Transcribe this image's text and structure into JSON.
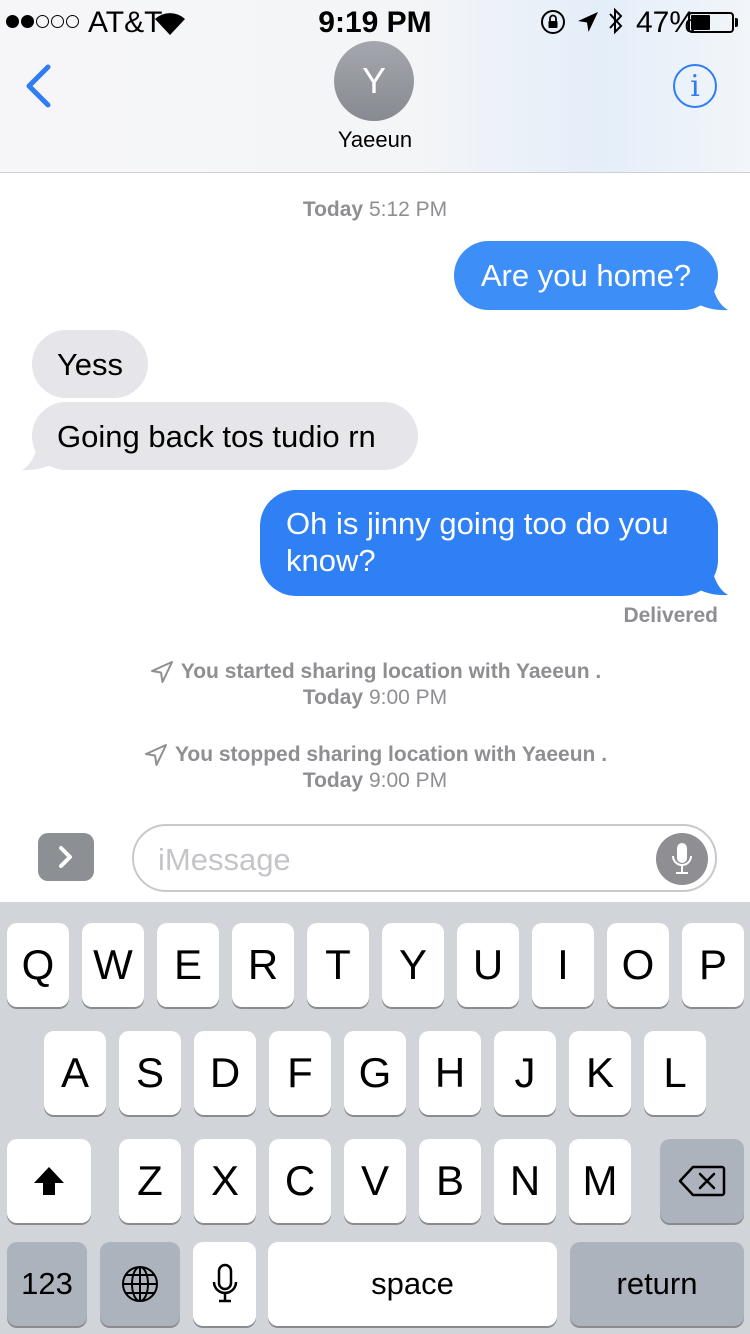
{
  "status_bar": {
    "carrier": "AT&T",
    "time": "9:19 PM",
    "battery_percent": "47%",
    "battery_level": 0.47,
    "signal_bars_filled": 2,
    "signal_bars_total": 5
  },
  "header": {
    "avatar_initial": "Y",
    "contact_name": "Yaeeun",
    "info_label": "i"
  },
  "conversation": {
    "timestamp_day": "Today",
    "timestamp_time": "5:12 PM",
    "messages": [
      {
        "direction": "outgoing",
        "text": "Are you home?"
      },
      {
        "direction": "incoming",
        "text": "Yess"
      },
      {
        "direction": "incoming",
        "text": "Going back tos tudio rn"
      },
      {
        "direction": "outgoing",
        "text": "Oh is jinny going too do you know?"
      }
    ],
    "delivered_label": "Delivered",
    "events": [
      {
        "text": "You started sharing location with Yaeeun .",
        "day": "Today",
        "time": "9:00 PM"
      },
      {
        "text": "You stopped sharing location with Yaeeun .",
        "day": "Today",
        "time": "9:00 PM"
      }
    ]
  },
  "input_bar": {
    "placeholder": "iMessage"
  },
  "keyboard": {
    "row1": [
      "Q",
      "W",
      "E",
      "R",
      "T",
      "Y",
      "U",
      "I",
      "O",
      "P"
    ],
    "row2": [
      "A",
      "S",
      "D",
      "F",
      "G",
      "H",
      "J",
      "K",
      "L"
    ],
    "row3": [
      "Z",
      "X",
      "C",
      "V",
      "B",
      "N",
      "M"
    ],
    "numbers_label": "123",
    "space_label": "space",
    "return_label": "return"
  },
  "colors": {
    "accent_blue": "#2f7cf6",
    "outgoing_bubble": "#3d8ef7",
    "incoming_bubble": "#e5e5ea",
    "keyboard_bg": "#d1d4d9"
  }
}
